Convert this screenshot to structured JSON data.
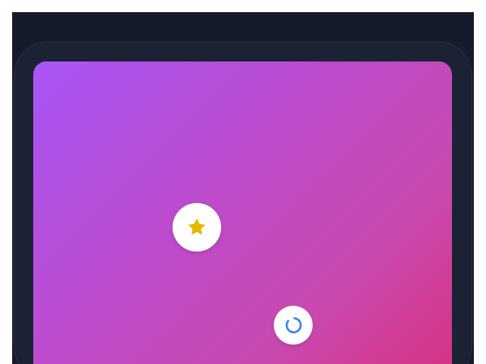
{
  "colors": {
    "app_background": "#151b2a",
    "phone_frame": "#1b2233",
    "gradient_start": "#a855f7",
    "gradient_middle": "#c94aaf",
    "gradient_end": "#d63384",
    "button_background": "#ffffff",
    "star_icon": "#e6b800",
    "refresh_icon": "#3b82f6"
  },
  "icons": {
    "star_button": "star-icon",
    "refresh_button": "refresh-icon"
  }
}
